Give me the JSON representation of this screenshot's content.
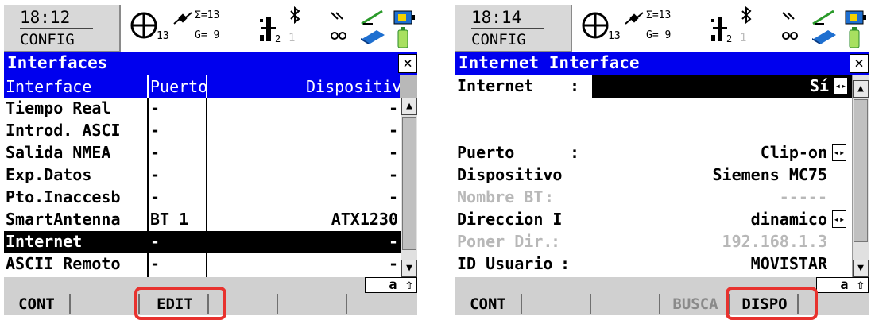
{
  "left": {
    "status": {
      "time": "18:12",
      "mode": "CONFIG",
      "sats_seen": "13",
      "sigma": "Σ=13",
      "gps": "G= 9",
      "rtk_count": "1",
      "rtk_sub": "2"
    },
    "title": "Interfaces",
    "columns": [
      "Interface",
      "Puerto",
      "Dispositivo"
    ],
    "rows": [
      {
        "interface": "Tiempo Real",
        "port": "-",
        "device": "-"
      },
      {
        "interface": "Introd. ASCI",
        "port": "-",
        "device": "-"
      },
      {
        "interface": "Salida NMEA",
        "port": "-",
        "device": "-"
      },
      {
        "interface": "Exp.Datos",
        "port": "-",
        "device": "-"
      },
      {
        "interface": "Pto.Inaccesb",
        "port": "-",
        "device": "-"
      },
      {
        "interface": "SmartAntenna",
        "port": "BT 1",
        "device": "ATX1230"
      },
      {
        "interface": "Internet",
        "port": "-",
        "device": "-"
      },
      {
        "interface": "ASCII Remoto",
        "port": "-",
        "device": "-"
      }
    ],
    "keyboard": "a ⇧",
    "fkeys": [
      "CONT",
      "",
      "EDIT",
      "",
      "",
      ""
    ]
  },
  "right": {
    "status": {
      "time": "18:14",
      "mode": "CONFIG",
      "sats_seen": "13",
      "sigma": "Σ=13",
      "gps": "G= 9",
      "rtk_count": "1",
      "rtk_sub": "2"
    },
    "title": "Internet Interface",
    "internet_label": "Internet",
    "internet_colon": ":",
    "internet_value": "Sí",
    "fields": [
      {
        "label": "Puerto",
        "colon": ":",
        "value": "Clip-on"
      },
      {
        "label": "Dispositivo",
        "colon": "",
        "value": "Siemens MC75"
      },
      {
        "label": "Nombre BT",
        "colon": ":",
        "value": "-----"
      },
      {
        "label": "Direccion I",
        "colon": "",
        "value": "dinamico"
      },
      {
        "label": "Poner Dir.",
        "colon": ":",
        "value": "192.168.1.3"
      },
      {
        "label": "ID Usuario",
        "colon": ":",
        "value": "MOVISTAR"
      }
    ],
    "keyboard": "a ⇧",
    "fkeys": [
      "CONT",
      "",
      "",
      "BUSCA",
      "DISPO",
      ""
    ]
  }
}
